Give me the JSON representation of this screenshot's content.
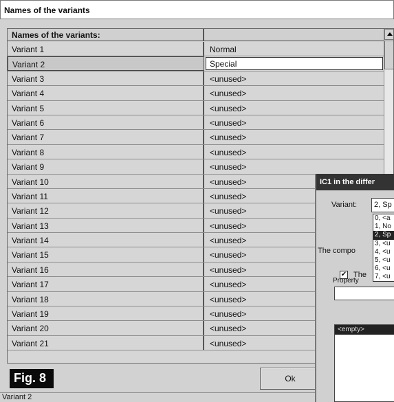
{
  "window": {
    "title": "Names of the variants",
    "grid_header": "Names of the variants:",
    "rows": [
      {
        "name": "Variant 1",
        "value": "Normal"
      },
      {
        "name": "Variant 2",
        "value": "Special"
      },
      {
        "name": "Variant 3",
        "value": "<unused>"
      },
      {
        "name": "Variant 4",
        "value": "<unused>"
      },
      {
        "name": "Variant 5",
        "value": "<unused>"
      },
      {
        "name": "Variant 6",
        "value": "<unused>"
      },
      {
        "name": "Variant 7",
        "value": "<unused>"
      },
      {
        "name": "Variant 8",
        "value": "<unused>"
      },
      {
        "name": "Variant 9",
        "value": "<unused>"
      },
      {
        "name": "Variant 10",
        "value": "<unused>"
      },
      {
        "name": "Variant 11",
        "value": "<unused>"
      },
      {
        "name": "Variant 12",
        "value": "<unused>"
      },
      {
        "name": "Variant 13",
        "value": "<unused>"
      },
      {
        "name": "Variant 14",
        "value": "<unused>"
      },
      {
        "name": "Variant 15",
        "value": "<unused>"
      },
      {
        "name": "Variant 16",
        "value": "<unused>"
      },
      {
        "name": "Variant 17",
        "value": "<unused>"
      },
      {
        "name": "Variant 18",
        "value": "<unused>"
      },
      {
        "name": "Variant 19",
        "value": "<unused>"
      },
      {
        "name": "Variant 20",
        "value": "<unused>"
      },
      {
        "name": "Variant 21",
        "value": "<unused>"
      }
    ],
    "selected_row": 2,
    "figure_label": "Fig. 8",
    "ok_label": "Ok",
    "status_text": "Variant 2"
  },
  "dialog": {
    "title": "IC1 in the differ",
    "variant_label": "Variant:",
    "variant_value": "2, Sp",
    "dropdown_items": [
      "0, <a",
      "1, No",
      "2, Sp",
      "3, <u",
      "4, <u",
      "5, <u",
      "6, <u",
      "7, <u"
    ],
    "dropdown_selected": "2, Sp",
    "component_label": "The compo",
    "checkbox_label": "The",
    "checkbox_checked": true,
    "checkbox_mark": "✔",
    "property_label": "Property",
    "list_header": "<empty>"
  }
}
